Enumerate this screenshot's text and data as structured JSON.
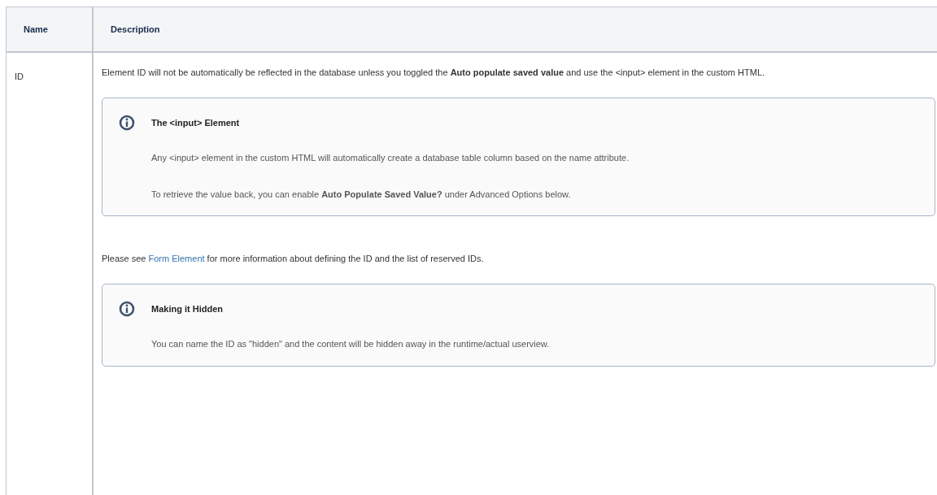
{
  "table": {
    "columns": [
      "Name",
      "Description"
    ],
    "rows": [
      {
        "name": "ID",
        "description": [
          {
            "kind": "paragraph",
            "text": "Element ID will not be automatically be reflected in the database unless you toggled the **Auto populate saved value** and use the <input> element in the custom HTML."
          },
          {
            "kind": "info_panel",
            "title": "The <input> Element",
            "paragraphs": [
              "Any <input> element in the custom HTML will automatically create a database table column based on the name attribute.",
              "To retrieve the value back, you can enable **Auto Populate Saved Value?** under Advanced Options below."
            ]
          },
          {
            "kind": "link_paragraph",
            "before": "Please see ",
            "link": "Form Element",
            "after": " for more information about defining the ID and the list of reserved IDs."
          },
          {
            "kind": "info_panel",
            "title": "Making it Hidden",
            "paragraphs": [
              "You can name the ID as \"hidden\" and the content will be hidden away in the runtime/actual userview."
            ]
          }
        ]
      }
    ]
  }
}
